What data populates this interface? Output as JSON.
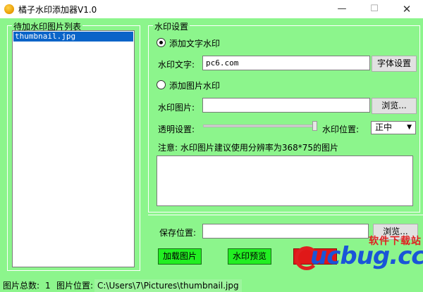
{
  "window": {
    "title": "橘子水印添加器V1.0",
    "minimize": "—",
    "maximize": "☐",
    "close": "✕"
  },
  "list_group": {
    "title": "待加水印图片列表",
    "items": [
      "thumbnail.jpg"
    ]
  },
  "settings": {
    "title": "水印设置",
    "text_radio_label": "添加文字水印",
    "text_radio_checked": true,
    "text_label": "水印文字:",
    "text_value": "pc6.com",
    "font_button": "字体设置",
    "image_radio_label": "添加图片水印",
    "image_radio_checked": false,
    "image_label": "水印图片:",
    "image_value": "",
    "browse_button": "浏览...",
    "opacity_label": "透明设置:",
    "opacity_value": 1.0,
    "position_label": "水印位置:",
    "position_value": "正中",
    "note": "注意: 水印图片建议使用分辨率为368*75的图片"
  },
  "save": {
    "label": "保存位置:",
    "value": "",
    "browse_button": "浏览..."
  },
  "actions": {
    "load_button": "加载图片",
    "preview_button": "水印预览"
  },
  "status": {
    "count_label": "图片总数:",
    "count_value": "1",
    "path_label": "图片位置:",
    "path_value": "C:\\Users\\7\\Pictures\\thumbnail.jpg"
  },
  "watermark": {
    "top_text": "软件下载站",
    "main_text": "ucbug.cc"
  },
  "colors": {
    "background": "#8cf58c",
    "green_button": "#22ee22",
    "selection": "#0a64c8"
  }
}
